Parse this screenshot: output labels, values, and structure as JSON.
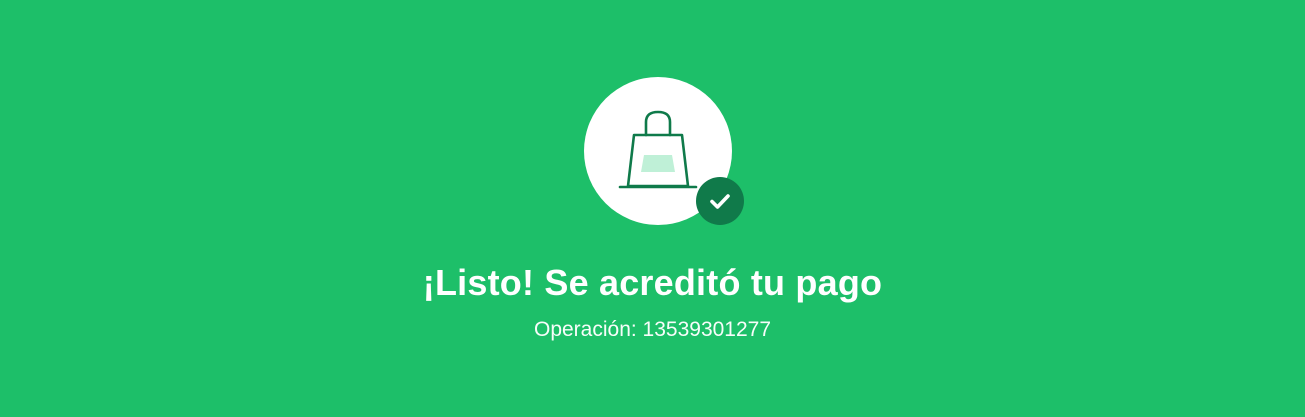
{
  "colors": {
    "background": "#1dbf69",
    "circle": "#ffffff",
    "bag_stroke": "#0f7a4a",
    "bag_fill": "#bff0d7",
    "badge": "#107a4a",
    "text": "#ffffff"
  },
  "icons": {
    "main": "shopping-bag-icon",
    "badge": "check-icon"
  },
  "confirmation": {
    "title": "¡Listo! Se acreditó tu pago",
    "operation": "Operación: 13539301277"
  }
}
